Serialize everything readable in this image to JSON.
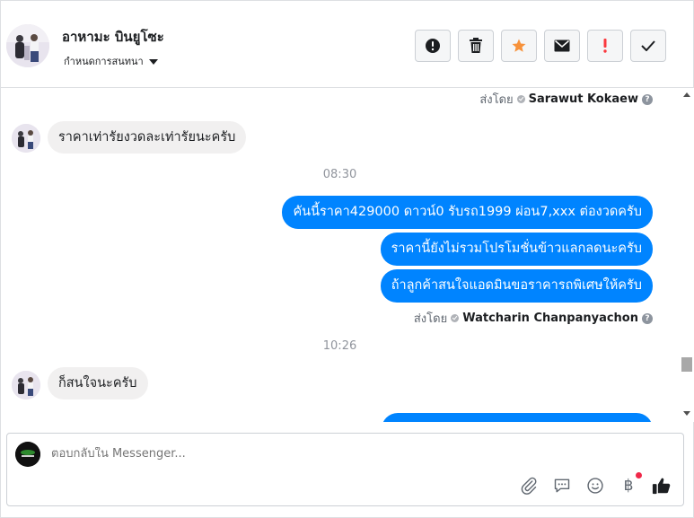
{
  "header": {
    "contact_name": "อาหามะ บินยูโซะ",
    "conversation_label": "กำหนดการสนทนา",
    "toolbar": [
      {
        "icon": "exclamation-circle-icon",
        "color": "#1c1e21"
      },
      {
        "icon": "trash-icon",
        "color": "#1c1e21"
      },
      {
        "icon": "star-icon",
        "color": "#f7923b"
      },
      {
        "icon": "envelope-icon",
        "color": "#1c1e21"
      },
      {
        "icon": "exclamation-icon",
        "color": "#fa383e"
      },
      {
        "icon": "check-icon",
        "color": "#1c1e21"
      }
    ]
  },
  "messages": {
    "sent_by_label": "ส่งโดย",
    "sender_top": "Sarawut Kokaew",
    "incoming_1": "ราคาเท่ารัยงวดละเท่ารัยนะครับ",
    "time_1": "08:30",
    "outgoing": [
      "คันนี้ราคา429000 ดาวน์0   รับรถ1999 ผ่อน7,xxx ต่องวดครับ",
      "ราคานี้ยังไม่รวมโปรโมชั่นข้าวแลกลดนะครับ",
      "ถ้าลูกค้าสนใจแอดมินขอราคารถพิเศษให้ครับ"
    ],
    "sender_bottom": "Watcharin Chanpanyachon",
    "time_2": "10:26",
    "incoming_2": "ก็สนใจนะครับ",
    "bubble_color": "#0084ff",
    "help": "?"
  },
  "composer": {
    "placeholder": "ตอบกลับใน Messenger...",
    "icons": [
      "paperclip-icon",
      "chat-bubble-icon",
      "smiley-icon",
      "baht-icon",
      "thumbs-up-icon"
    ],
    "baht_symbol": "฿"
  }
}
